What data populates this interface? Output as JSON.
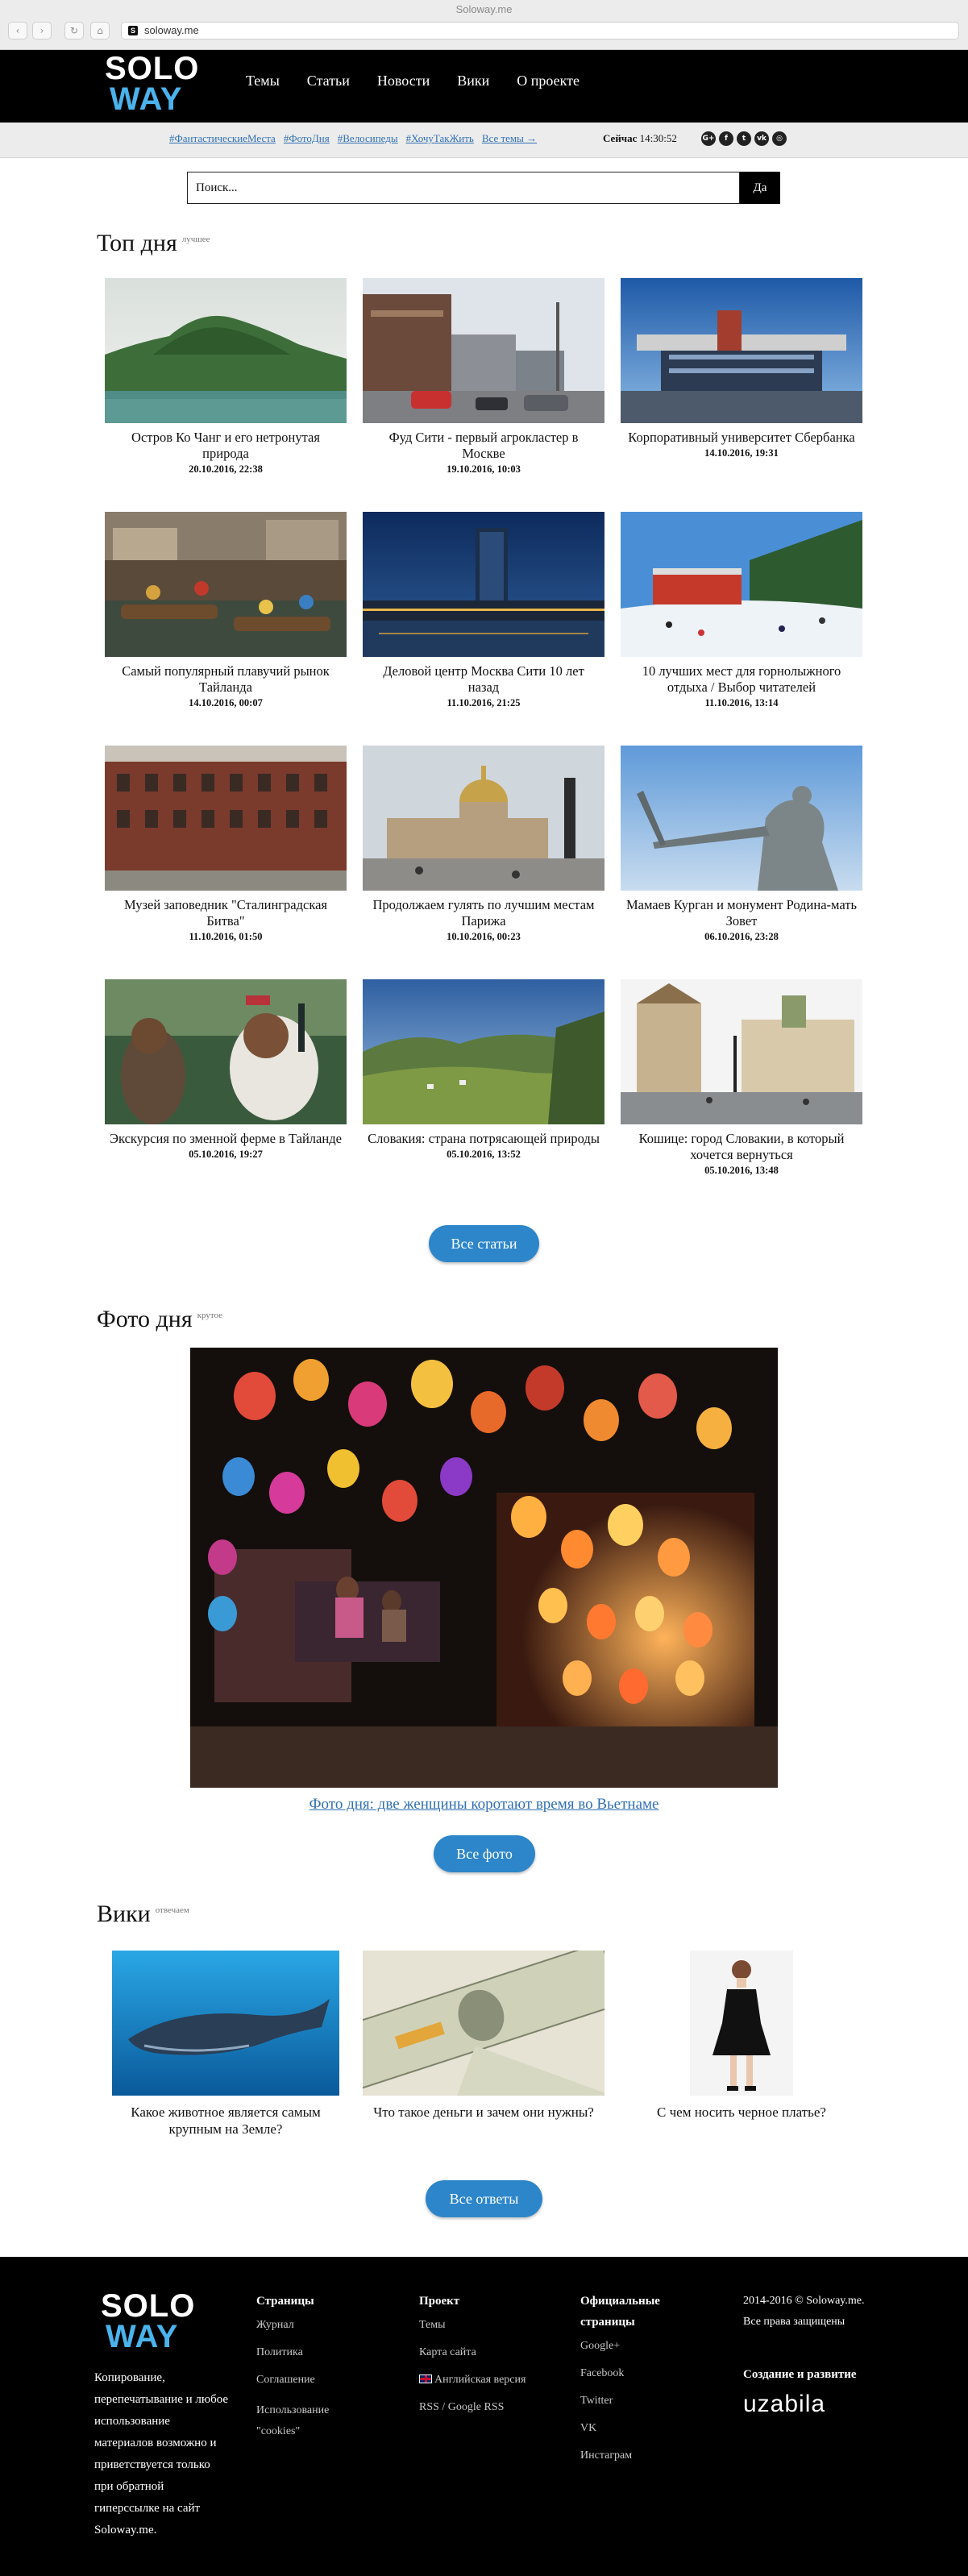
{
  "browser": {
    "window_title": "Soloway.me",
    "url": "soloway.me",
    "back_glyph": "‹",
    "forward_glyph": "›",
    "reload_glyph": "↻",
    "home_glyph": "⌂"
  },
  "header": {
    "logo_top": "SOLO",
    "logo_bottom": "WAY",
    "nav": [
      "Темы",
      "Статьи",
      "Новости",
      "Вики",
      "О проекте"
    ]
  },
  "tagbar": {
    "tags": [
      "#ФантастическиеМеста",
      "#ФотоДня",
      "#Велосипеды",
      "#ХочуТакЖить",
      "Все темы →"
    ],
    "now_label": "Сейчас",
    "now_time": "14:30:52",
    "socials": [
      "G+",
      "f",
      "t",
      "vk",
      "◎"
    ]
  },
  "search": {
    "placeholder": "Поиск...",
    "button_label": "Да"
  },
  "top_day": {
    "title": "Топ дня",
    "subtitle": "лучшее",
    "articles": [
      {
        "title": "Остров Ко Чанг и его нетронутая природа",
        "date": "20.10.2016, 22:38"
      },
      {
        "title": "Фуд Сити - первый агрокластер в Москве",
        "date": "19.10.2016, 10:03"
      },
      {
        "title": "Корпоративный университет Сбербанка",
        "date": "14.10.2016, 19:31"
      },
      {
        "title": "Самый популярный плавучий рынок Тайланда",
        "date": "14.10.2016, 00:07"
      },
      {
        "title": "Деловой центр Москва Сити 10 лет назад",
        "date": "11.10.2016, 21:25"
      },
      {
        "title": "10 лучших мест для горнолыжного отдыха / Выбор читателей",
        "date": "11.10.2016, 13:14"
      },
      {
        "title": "Музей заповедник \"Сталинградская Битва\"",
        "date": "11.10.2016, 01:50"
      },
      {
        "title": "Продолжаем гулять по лучшим местам Парижа",
        "date": "10.10.2016, 00:23"
      },
      {
        "title": "Мамаев Курган и монумент Родина-мать Зовет",
        "date": "06.10.2016, 23:28"
      },
      {
        "title": "Экскурсия по зменной ферме в Тайланде",
        "date": "05.10.2016, 19:27"
      },
      {
        "title": "Словакия: страна потрясающей природы",
        "date": "05.10.2016, 13:52"
      },
      {
        "title": "Кошице: город Словакии, в который хочется вернуться",
        "date": "05.10.2016, 13:48"
      }
    ],
    "all_button": "Все статьи"
  },
  "photo_day": {
    "title": "Фото дня",
    "subtitle": "крутое",
    "caption": "Фото дня: две женщины коротают время во Вьетнаме",
    "all_button": "Все фото"
  },
  "wiki": {
    "title": "Вики",
    "subtitle": "отвечаем",
    "items": [
      {
        "title": "Какое животное является самым крупным на Земле?"
      },
      {
        "title": "Что такое деньги и зачем они нужны?"
      },
      {
        "title": "С чем носить черное платье?"
      }
    ],
    "all_button": "Все ответы"
  },
  "footer": {
    "logo_top": "SOLO",
    "logo_bottom": "WAY",
    "note": "Копирование, перепечатывание и любое использование материалов возможно и приветствуется только при обратной гиперссылке на сайт Soloway.me.",
    "col_pages": {
      "title": "Страницы",
      "links": [
        "Журнал",
        "Политика",
        "Соглашение",
        "Использование \"cookies\""
      ]
    },
    "col_project": {
      "title": "Проект",
      "links": [
        "Темы",
        "Карта сайта",
        "Английская версия",
        "RSS / Google RSS"
      ]
    },
    "col_official": {
      "title": "Официальные страницы",
      "links": [
        "Google+",
        "Facebook",
        "Twitter",
        "VK",
        "Инстаграм"
      ]
    },
    "copyright": "2014-2016 © Soloway.me. Все права защищены",
    "made_by_label": "Создание и развитие",
    "made_by": "uzabila"
  },
  "colors": {
    "accent": "#2d86c9",
    "logo_blue": "#4ab3ec",
    "link": "#2f6fb3",
    "header_bg": "#000000"
  }
}
